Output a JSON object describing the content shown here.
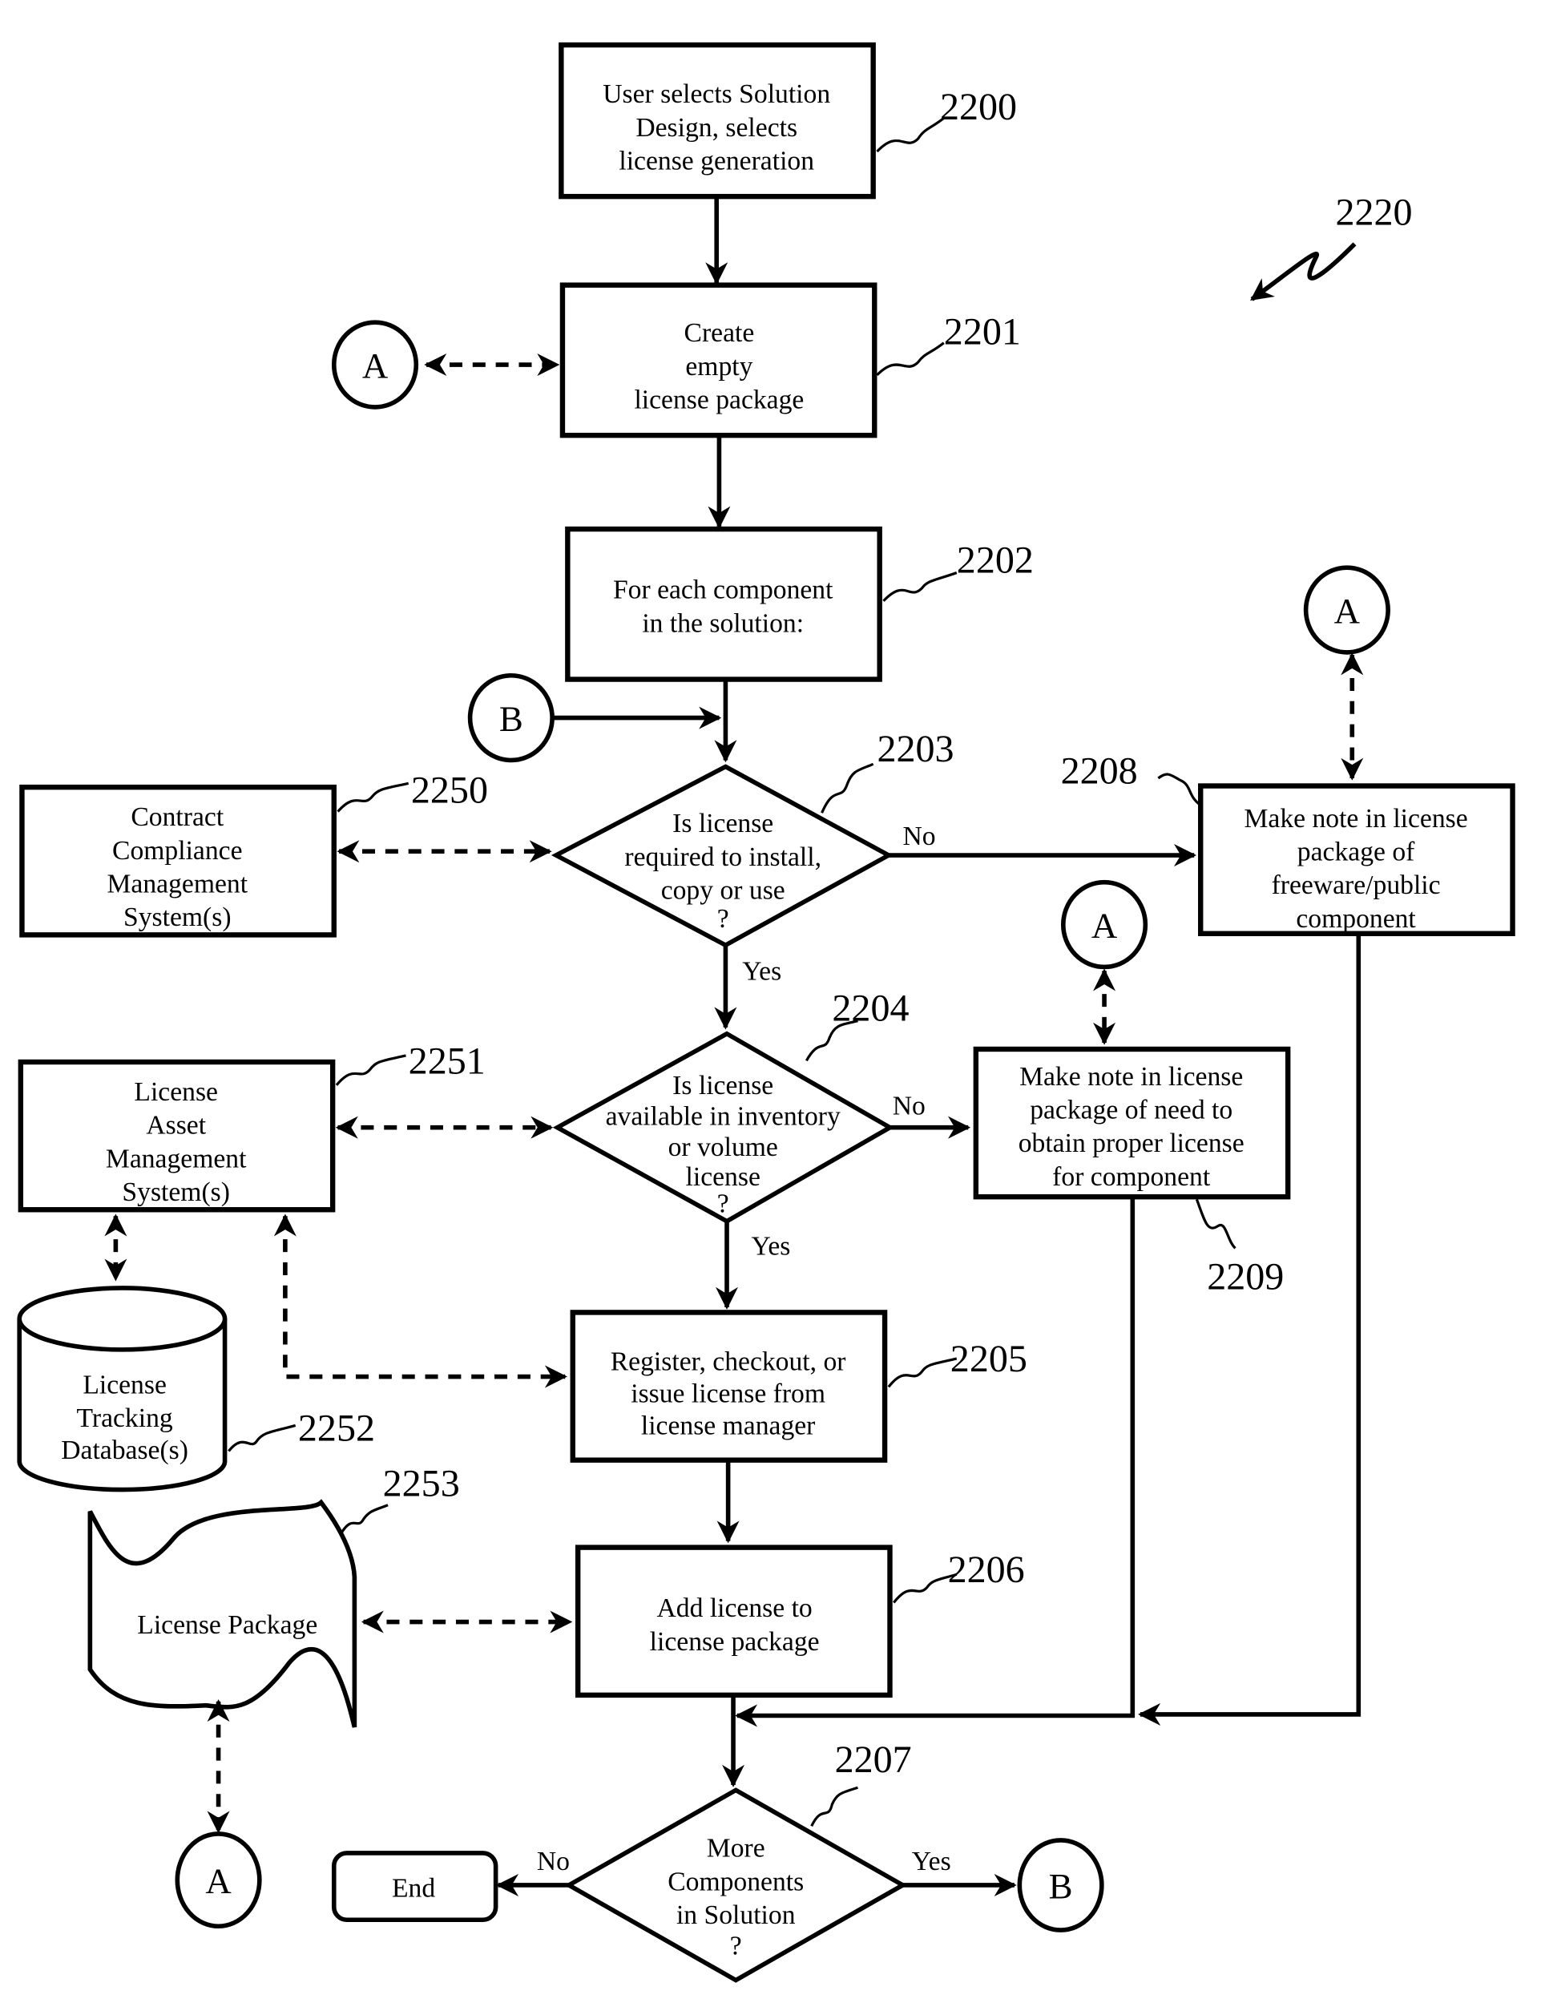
{
  "figure": {
    "reference": "2220",
    "nodes": {
      "n2200": {
        "ref": "2200",
        "type": "process",
        "lines": [
          "User selects Solution",
          "Design, selects",
          "license generation"
        ]
      },
      "n2201": {
        "ref": "2201",
        "type": "process",
        "lines": [
          "Create",
          "empty",
          "license package"
        ]
      },
      "n2202": {
        "ref": "2202",
        "type": "process",
        "lines": [
          "For each component",
          "in the solution:"
        ]
      },
      "n2203": {
        "ref": "2203",
        "type": "decision",
        "lines": [
          "Is license",
          "required to install,",
          "copy or use",
          "?"
        ]
      },
      "n2204": {
        "ref": "2204",
        "type": "decision",
        "lines": [
          "Is license",
          "available in inventory",
          "or volume",
          "license",
          "?"
        ]
      },
      "n2205": {
        "ref": "2205",
        "type": "process",
        "lines": [
          "Register, checkout, or",
          "issue license from",
          "license manager"
        ]
      },
      "n2206": {
        "ref": "2206",
        "type": "process",
        "lines": [
          "Add license to",
          "license package"
        ]
      },
      "n2207": {
        "ref": "2207",
        "type": "decision",
        "lines": [
          "More",
          "Components",
          "in Solution",
          "?"
        ]
      },
      "n2208": {
        "ref": "2208",
        "type": "process",
        "lines": [
          "Make note in license",
          "package of",
          "freeware/public",
          "component"
        ]
      },
      "n2209": {
        "ref": "2209",
        "type": "process",
        "lines": [
          "Make note in license",
          "package of need to",
          "obtain proper license",
          "for component"
        ]
      },
      "n2250": {
        "ref": "2250",
        "type": "process",
        "lines": [
          "Contract",
          "Compliance",
          "Management",
          "System(s)"
        ]
      },
      "n2251": {
        "ref": "2251",
        "type": "process",
        "lines": [
          "License",
          "Asset",
          "Management",
          "System(s)"
        ]
      },
      "n2252": {
        "ref": "2252",
        "type": "database",
        "lines": [
          "License",
          "Tracking",
          "Database(s)"
        ]
      },
      "n2253": {
        "ref": "2253",
        "type": "document",
        "lines": [
          "License Package"
        ]
      },
      "end": {
        "type": "terminal",
        "label": "End"
      }
    },
    "connectors": {
      "a": "A",
      "b": "B"
    },
    "edge_labels": {
      "yes": "Yes",
      "no": "No"
    }
  }
}
